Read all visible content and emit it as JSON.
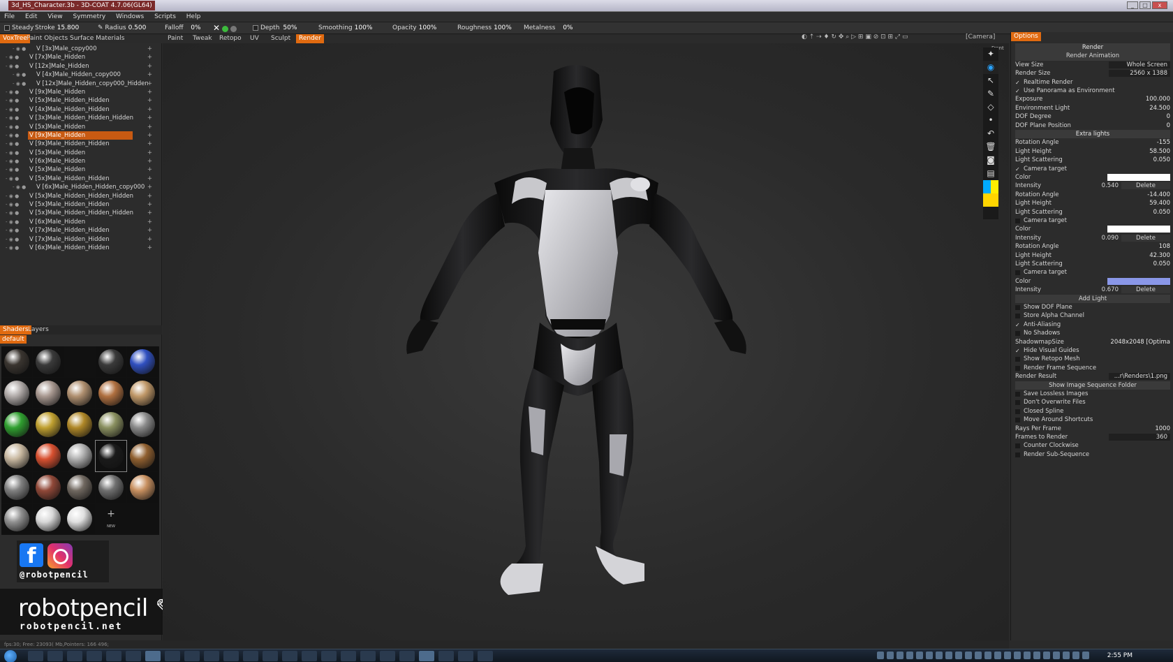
{
  "window": {
    "title": "3d_HS_Character.3b - 3D-COAT 4.7.06(GL64)"
  },
  "menu": [
    "File",
    "Edit",
    "View",
    "Symmetry",
    "Windows",
    "Scripts",
    "Help"
  ],
  "toolbar": {
    "steady": "Steady",
    "stroke_label": "Stroke",
    "stroke_value": "15.800",
    "radius_label": "Radius",
    "radius_value": "0.500",
    "falloff_label": "Falloff",
    "falloff_value": "0%",
    "depth_label": "Depth",
    "depth_value": "50%",
    "smoothing_label": "Smoothing",
    "smoothing_value": "100%",
    "opacity_label": "Opacity",
    "opacity_value": "100%",
    "roughness_label": "Roughness",
    "roughness_value": "100%",
    "metalness_label": "Metalness",
    "metalness_value": "0%",
    "camera": "[Camera]"
  },
  "leftTabs": [
    "VoxTree",
    "Paint Objects",
    "Surface Materials"
  ],
  "roomTabs": [
    "Paint",
    "Tweak",
    "Retopo",
    "UV",
    "Sculpt",
    "Render"
  ],
  "voxtree": [
    "V  [3x]Male_copy000",
    "V  [7x]Male_Hidden",
    "V  [12x]Male_Hidden",
    "V  [4x]Male_Hidden_copy000",
    "V  [12x]Male_Hidden_copy000_Hidden",
    "V  [9x]Male_Hidden",
    "V  [5x]Male_Hidden_Hidden",
    "V  [4x]Male_Hidden_Hidden",
    "V  [3x]Male_Hidden_Hidden_Hidden",
    "V  [5x]Male_Hidden",
    "V  [9x]Male_Hidden",
    "V  [9x]Male_Hidden_Hidden",
    "V  [5x]Male_Hidden",
    "V  [6x]Male_Hidden",
    "V  [5x]Male_Hidden",
    "V  [5x]Male_Hidden_Hidden",
    "V  [6x]Male_Hidden_Hidden_copy000",
    "V  [5x]Male_Hidden_Hidden_Hidden",
    "V  [5x]Male_Hidden_Hidden",
    "V  [5x]Male_Hidden_Hidden_Hidden",
    "V  [6x]Male_Hidden",
    "V  [7x]Male_Hidden_Hidden",
    "V  [7x]Male_Hidden_Hidden",
    "V  [6x]Male_Hidden_Hidden"
  ],
  "shaderTabs": [
    "Shaders",
    "Layers"
  ],
  "shaderPreset": "default",
  "shaderNew": "NEW",
  "social": {
    "handle": "@robotpencil"
  },
  "brand": {
    "name": "robotpencil",
    "url": "robotpencil.net"
  },
  "viewport": {
    "view_label": "Front"
  },
  "options": {
    "tab": "Options",
    "render_header": "Render",
    "render_animation": "Render Animation",
    "view_size_label": "View Size",
    "view_size_value": "Whole Screen",
    "render_size_label": "Render Size",
    "render_size_value": "2560 x 1388",
    "realtime_render": "Realtime Render",
    "use_panorama": "Use Panorama as Environment",
    "exposure_label": "Exposure",
    "exposure_value": "100.000",
    "env_light_label": "Environment Light",
    "env_light_value": "24.500",
    "dof_degree_label": "DOF Degree",
    "dof_degree_value": "0",
    "dof_plane_label": "DOF Plane Position",
    "dof_plane_value": "0",
    "extra_lights": "Extra lights",
    "lights": [
      {
        "rotation": "-155",
        "height": "58.500",
        "scattering": "0.050",
        "intensity": "0.540",
        "color": "#ffffff"
      },
      {
        "rotation": "-14.400",
        "height": "59.400",
        "scattering": "0.050",
        "intensity": "0.090",
        "color": "#ffffff"
      },
      {
        "rotation": "108",
        "height": "42.300",
        "scattering": "0.050",
        "intensity": "0.670",
        "color": "#8a97e8"
      }
    ],
    "light_labels": {
      "rotation": "Rotation Angle",
      "height": "Light Height",
      "scattering": "Light Scattering",
      "camera_target": "Camera target",
      "color": "Color",
      "intensity": "Intensity",
      "delete": "Delete"
    },
    "add_light": "Add Light",
    "show_dof": "Show DOF Plane",
    "store_alpha": "Store Alpha Channel",
    "anti_alias": "Anti-Aliasing",
    "no_shadows": "No Shadows",
    "shadowmap_label": "ShadowmapSize",
    "shadowmap_value": "2048x2048 [Optima",
    "hide_guides": "Hide Visual Guides",
    "show_retopo": "Show Retopo Mesh",
    "render_frame_seq": "Render Frame Sequence",
    "render_result_label": "Render Result",
    "render_result_value": "...r\\Renders\\1.png",
    "show_seq_folder": "Show Image Sequence Folder",
    "save_lossless": "Save Lossless Images",
    "dont_overwrite": "Don't Overwrite Files",
    "closed_spline": "Closed Spline",
    "move_shortcuts": "Move Around Shortcuts",
    "rays_label": "Rays Per Frame",
    "rays_value": "1000",
    "frames_label": "Frames to Render",
    "frames_value": "360",
    "counter_cw": "Counter Clockwise",
    "render_sub": "Render Sub-Sequence"
  },
  "status": {
    "text": "fps:30;   Free: 23093( Mb,Pointers: 166  496;"
  },
  "taskbar": {
    "clock": "2:55 PM"
  }
}
